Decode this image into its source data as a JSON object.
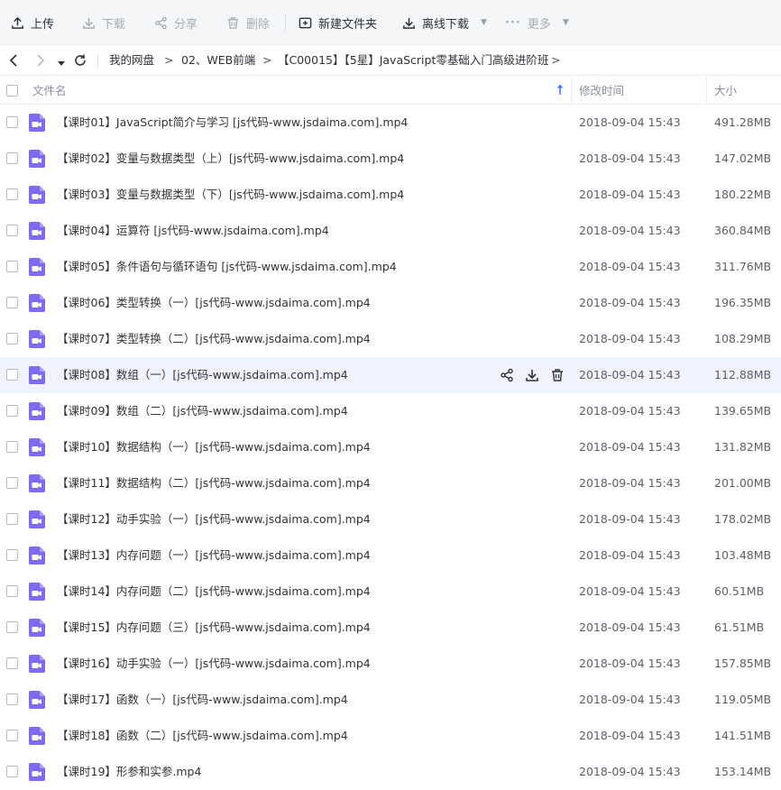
{
  "toolbar": {
    "upload": "上传",
    "download": "下载",
    "share": "分享",
    "delete": "删除",
    "new_folder": "新建文件夹",
    "offline_download": "离线下载",
    "more": "更多"
  },
  "breadcrumb": {
    "items": [
      "我的网盘",
      "02、WEB前端",
      "【C00015】【5星】JavaScript零基础入门高级进阶班"
    ],
    "separator": ">"
  },
  "header": {
    "name": "文件名",
    "modified": "修改时间",
    "size": "大小"
  },
  "colors": {
    "accent": "#3b74f2",
    "video_icon": "#7b6cf0",
    "hover_row": "#eef3ff"
  },
  "files": [
    {
      "name": "【课时01】JavaScript简介与学习 [js代码-www.jsdaima.com].mp4",
      "time": "2018-09-04 15:43",
      "size": "491.28MB"
    },
    {
      "name": "【课时02】变量与数据类型（上）[js代码-www.jsdaima.com].mp4",
      "time": "2018-09-04 15:43",
      "size": "147.02MB"
    },
    {
      "name": "【课时03】变量与数据类型（下）[js代码-www.jsdaima.com].mp4",
      "time": "2018-09-04 15:43",
      "size": "180.22MB"
    },
    {
      "name": "【课时04】运算符 [js代码-www.jsdaima.com].mp4",
      "time": "2018-09-04 15:43",
      "size": "360.84MB"
    },
    {
      "name": "【课时05】条件语句与循环语句 [js代码-www.jsdaima.com].mp4",
      "time": "2018-09-04 15:43",
      "size": "311.76MB"
    },
    {
      "name": "【课时06】类型转换（一）[js代码-www.jsdaima.com].mp4",
      "time": "2018-09-04 15:43",
      "size": "196.35MB"
    },
    {
      "name": "【课时07】类型转换（二）[js代码-www.jsdaima.com].mp4",
      "time": "2018-09-04 15:43",
      "size": "108.29MB"
    },
    {
      "name": "【课时08】数组（一）[js代码-www.jsdaima.com].mp4",
      "time": "2018-09-04 15:43",
      "size": "112.88MB"
    },
    {
      "name": "【课时09】数组（二）[js代码-www.jsdaima.com].mp4",
      "time": "2018-09-04 15:43",
      "size": "139.65MB"
    },
    {
      "name": "【课时10】数据结构（一）[js代码-www.jsdaima.com].mp4",
      "time": "2018-09-04 15:43",
      "size": "131.82MB"
    },
    {
      "name": "【课时11】数据结构（二）[js代码-www.jsdaima.com].mp4",
      "time": "2018-09-04 15:43",
      "size": "201.00MB"
    },
    {
      "name": "【课时12】动手实验（一）[js代码-www.jsdaima.com].mp4",
      "time": "2018-09-04 15:43",
      "size": "178.02MB"
    },
    {
      "name": "【课时13】内存问题（一）[js代码-www.jsdaima.com].mp4",
      "time": "2018-09-04 15:43",
      "size": "103.48MB"
    },
    {
      "name": "【课时14】内存问题（二）[js代码-www.jsdaima.com].mp4",
      "time": "2018-09-04 15:43",
      "size": "60.51MB"
    },
    {
      "name": "【课时15】内存问题（三）[js代码-www.jsdaima.com].mp4",
      "time": "2018-09-04 15:43",
      "size": "61.51MB"
    },
    {
      "name": "【课时16】动手实验（一）[js代码-www.jsdaima.com].mp4",
      "time": "2018-09-04 15:43",
      "size": "157.85MB"
    },
    {
      "name": "【课时17】函数（一）[js代码-www.jsdaima.com].mp4",
      "time": "2018-09-04 15:43",
      "size": "119.05MB"
    },
    {
      "name": "【课时18】函数（二）[js代码-www.jsdaima.com].mp4",
      "time": "2018-09-04 15:43",
      "size": "141.51MB"
    },
    {
      "name": "【课时19】形参和实参.mp4",
      "time": "2018-09-04 15:43",
      "size": "153.14MB"
    }
  ],
  "hovered_row_index": 7
}
